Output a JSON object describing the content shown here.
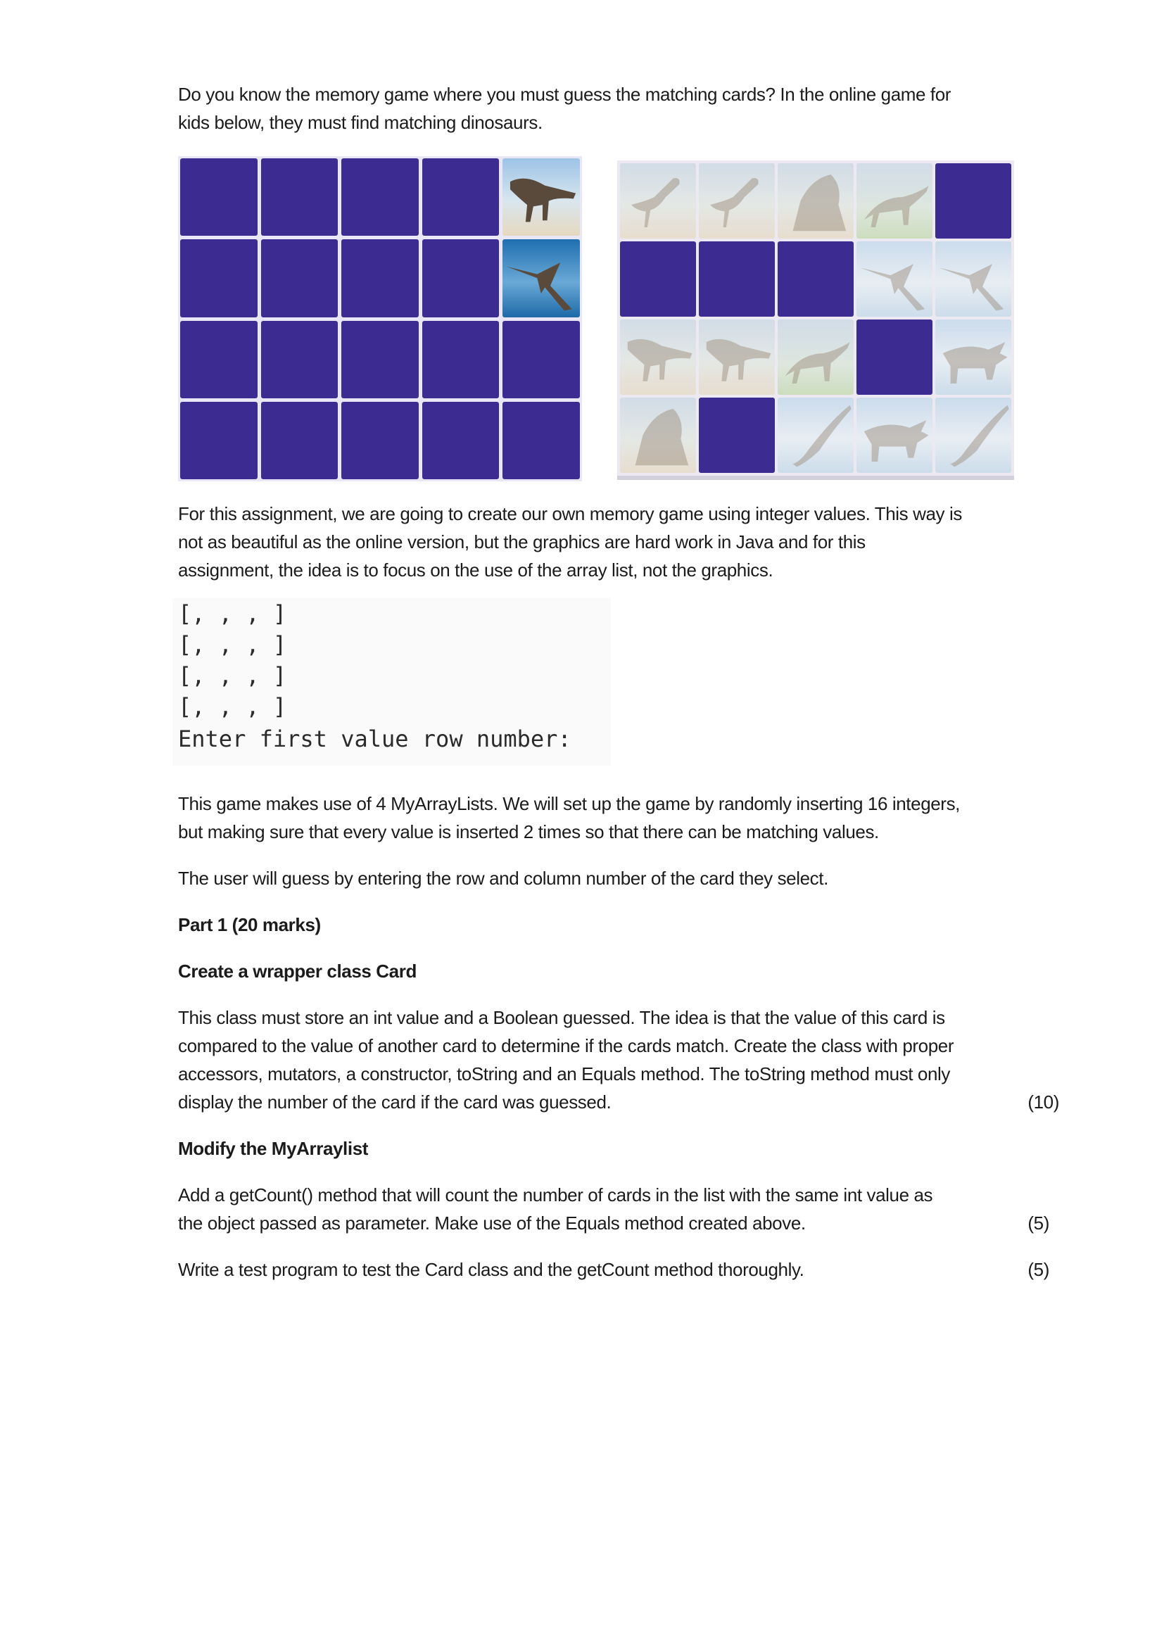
{
  "intro": {
    "line1": "Do you know the memory game where you must guess the matching cards? In the online game for",
    "line2": "kids below, they must find matching dinosaurs."
  },
  "game_images": {
    "left_grid": {
      "rows": 4,
      "cols": 5,
      "cards": [
        [
          "hidden",
          "hidden",
          "hidden",
          "hidden",
          "t-rex"
        ],
        [
          "hidden",
          "hidden",
          "hidden",
          "hidden",
          "pterosaur"
        ],
        [
          "hidden",
          "hidden",
          "hidden",
          "hidden",
          "hidden"
        ],
        [
          "hidden",
          "hidden",
          "hidden",
          "hidden",
          "hidden"
        ]
      ]
    },
    "right_grid": {
      "rows": 4,
      "cols": 5,
      "cards": [
        [
          "ostrich-dino",
          "ostrich-dino",
          "volcano-dino",
          "stegosaurus",
          "hidden"
        ],
        [
          "hidden",
          "hidden",
          "hidden",
          "pterosaur",
          "pterosaur"
        ],
        [
          "t-rex",
          "t-rex",
          "stegosaurus",
          "hidden",
          "triceratops"
        ],
        [
          "volcano-dino",
          "hidden",
          "long-neck",
          "triceratops",
          "long-neck"
        ]
      ]
    },
    "hidden_color": "#3c2c92"
  },
  "description": {
    "line1": "For this assignment, we are going to create our own memory game using integer values. This way is",
    "line2": "not as beautiful as the online version, but the graphics are hard work in Java and for this",
    "line3": "assignment, the idea is to focus on the use of the array list, not the graphics."
  },
  "console_output": {
    "rows": [
      "[, , , ]",
      "[, , , ]",
      "[, , , ]",
      "[, , , ]"
    ],
    "prompt": "Enter first value row number:"
  },
  "setup": {
    "line1": "This game makes use of 4 MyArrayLists. We will set up the game by randomly inserting 16 integers,",
    "line2": "but making sure that every value is inserted 2 times so that there can be matching values."
  },
  "guess_info": "The user will guess by entering the row and column number of the card they select.",
  "part1": {
    "heading": "Part 1 (20 marks)",
    "card_class": {
      "heading": "Create a wrapper class Card",
      "line1": "This class must store an int value and a Boolean guessed. The idea is that the value of this card is",
      "line2": "compared to the value of another card to determine if the cards match. Create the class with proper",
      "line3": "accessors, mutators, a constructor, toString and an Equals method. The toString method must only",
      "line4": "display the number of the card if the card was guessed.",
      "marks": "(10)"
    },
    "modify": {
      "heading": "Modify the MyArraylist",
      "line1": "Add a getCount() method that will count the number of cards in the list with the same int value as",
      "line2": "the object passed as parameter. Make use of the Equals method created above.",
      "marks": "(5)"
    },
    "test": {
      "line1": "Write a test program to test the Card class and the getCount method thoroughly.",
      "marks": "(5)"
    }
  }
}
